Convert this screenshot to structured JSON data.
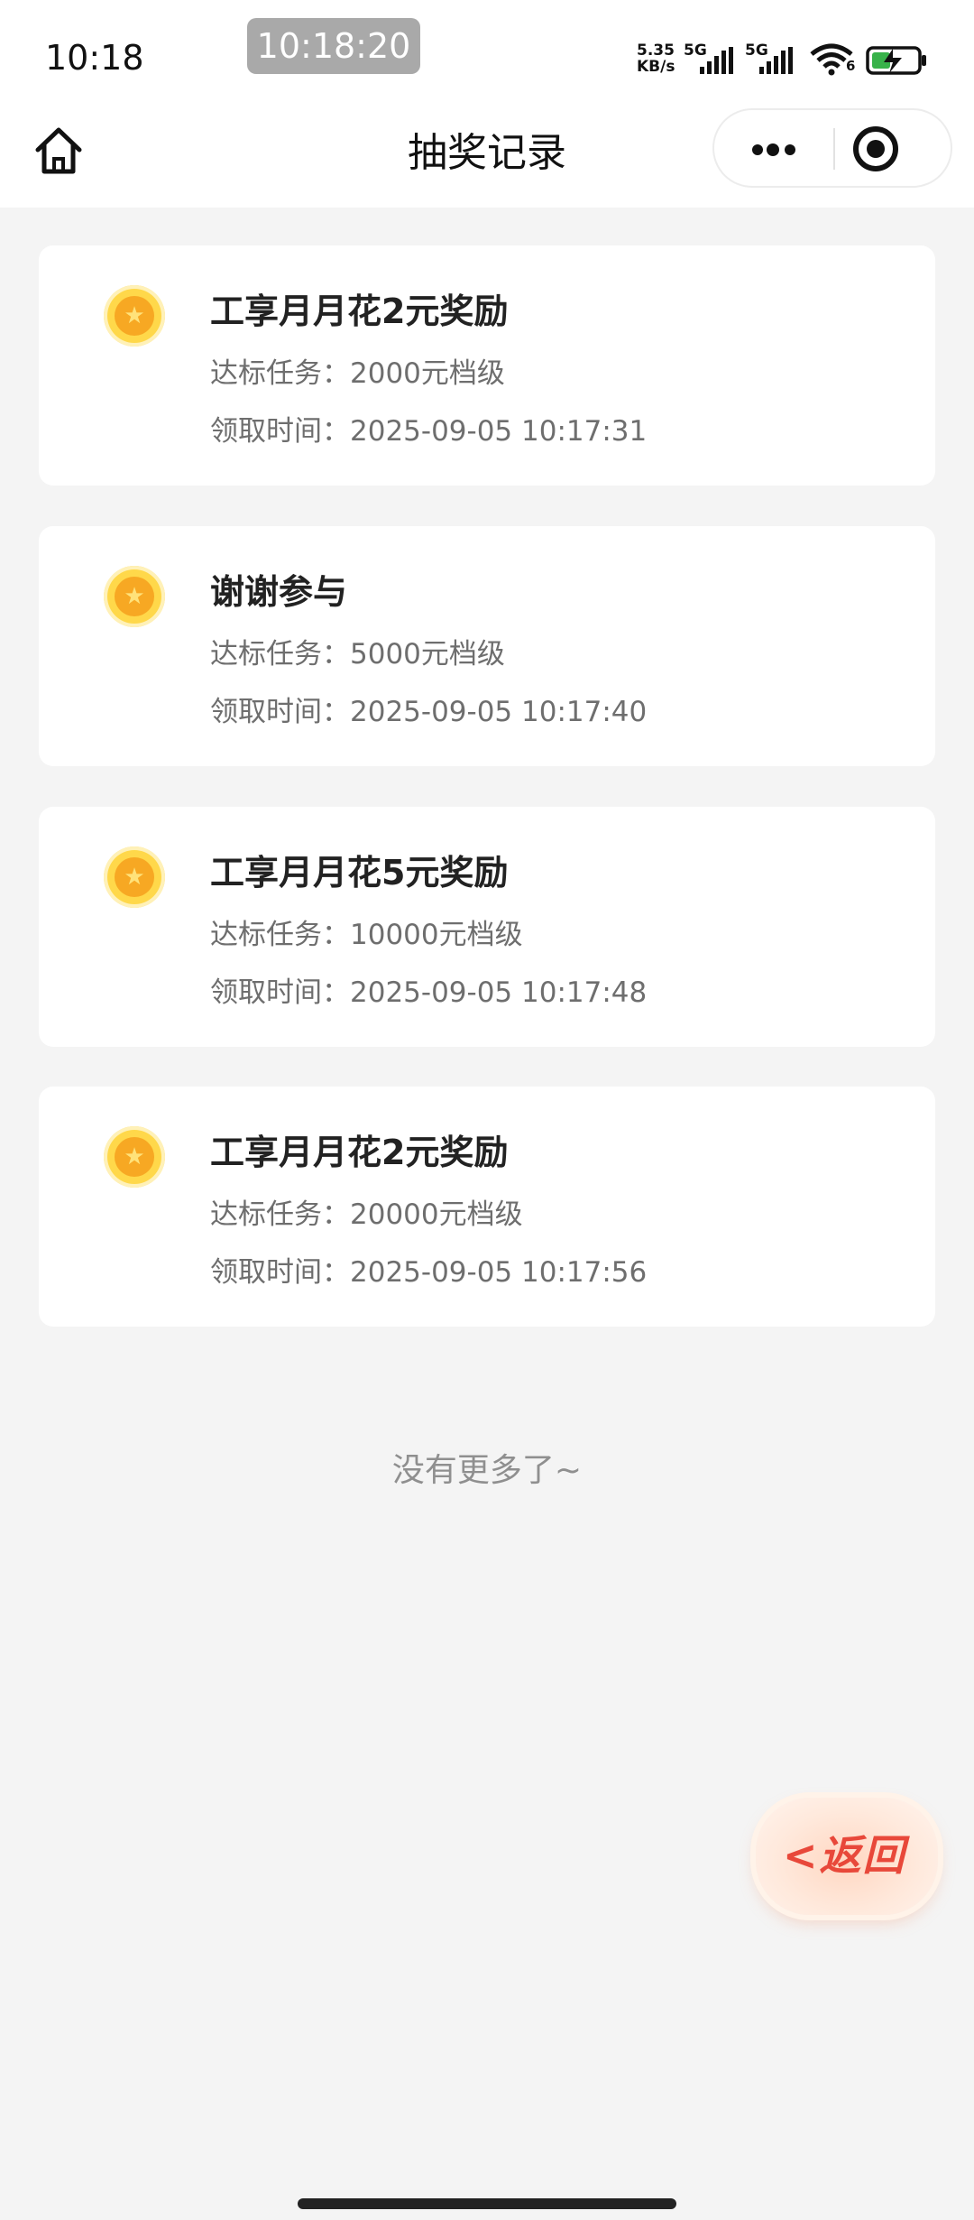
{
  "status_bar": {
    "time": "10:18",
    "recording_time": "10:18:20",
    "net_speed_value": "5.35",
    "net_speed_unit": "KB/s",
    "sim1_label": "5G",
    "sim2_label": "5G",
    "wifi_label": "6"
  },
  "nav": {
    "title": "抽奖记录"
  },
  "records": [
    {
      "title": "工享月月花2元奖励",
      "task_label": "达标任务：",
      "task_value": "2000元档级",
      "time_label": "领取时间：",
      "time_value": "2025-09-05 10:17:31"
    },
    {
      "title": "谢谢参与",
      "task_label": "达标任务：",
      "task_value": "5000元档级",
      "time_label": "领取时间：",
      "time_value": "2025-09-05 10:17:40"
    },
    {
      "title": "工享月月花5元奖励",
      "task_label": "达标任务：",
      "task_value": "10000元档级",
      "time_label": "领取时间：",
      "time_value": "2025-09-05 10:17:48"
    },
    {
      "title": "工享月月花2元奖励",
      "task_label": "达标任务：",
      "task_value": "20000元档级",
      "time_label": "领取时间：",
      "time_value": "2025-09-05 10:17:56"
    }
  ],
  "footer_text": "没有更多了~",
  "back_button_label": "<返回",
  "colors": {
    "medal_gold": "#f7a823",
    "back_red": "#e8483a",
    "page_bg": "#f4f4f4"
  }
}
